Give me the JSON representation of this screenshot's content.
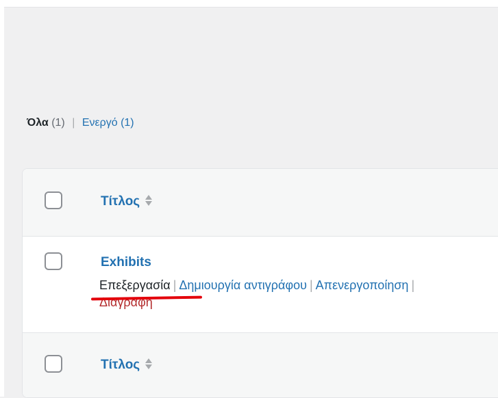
{
  "filters": {
    "all_label": "Όλα",
    "all_count": "(1)",
    "separator": "|",
    "active_label": "Ενεργό",
    "active_count": "(1)"
  },
  "table": {
    "header_title": "Τίτλος",
    "footer_title": "Τίτλος",
    "rows": [
      {
        "title": "Exhibits",
        "actions": {
          "edit": "Επεξεργασία",
          "duplicate": "Δημιουργία αντιγράφου",
          "deactivate": "Απενεργοποίηση",
          "delete": "Διαγραφή",
          "separator": "|"
        }
      }
    ]
  },
  "colors": {
    "link": "#2271b1",
    "delete": "#b32d2e",
    "highlight_underline": "#e3000b"
  }
}
